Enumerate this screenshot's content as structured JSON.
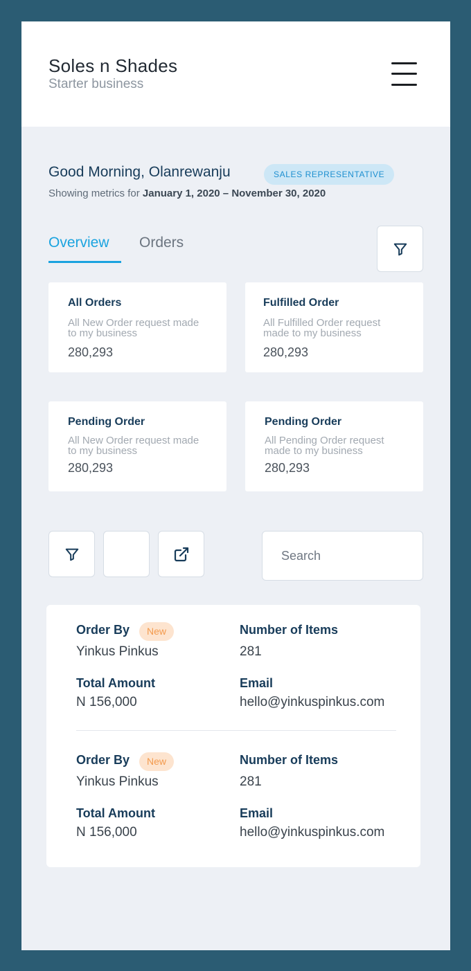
{
  "header": {
    "brand_name": "Soles n Shades",
    "brand_subtitle": "Starter business",
    "menu_icon": "hamburger-menu-icon"
  },
  "greeting": {
    "text": "Good Morning, Olanrewanju",
    "role_badge": "SALES REPRESENTATIVE",
    "metrics_prefix": "Showing metrics for ",
    "metrics_range": "January 1, 2020 – November 30, 2020"
  },
  "tabs": [
    {
      "label": "Overview",
      "active": true
    },
    {
      "label": "Orders",
      "active": false
    }
  ],
  "filter_icon": "filter-icon",
  "cards": [
    {
      "title": "All Orders",
      "description": "All New Order request made to my business",
      "value": "280,293"
    },
    {
      "title": "Fulfilled Order",
      "description": "All Fulfilled Order request made to my business",
      "value": "280,293"
    },
    {
      "title": "Pending Order",
      "description": "All New Order request made to my business",
      "value": "280,293"
    },
    {
      "title": "Pending Order",
      "description": "All Pending Order request made to my business",
      "value": "280,293"
    }
  ],
  "toolbar": {
    "filter_icon": "filter-icon",
    "export_icon": "external-link-icon",
    "search_placeholder": "Search"
  },
  "orders": [
    {
      "order_by_label": "Order By",
      "badge": "New",
      "order_by": "Yinkus Pinkus",
      "items_label": "Number of Items",
      "items": "281",
      "amount_label": "Total Amount",
      "amount": "N 156,000",
      "email_label": "Email",
      "email": "hello@yinkuspinkus.com"
    },
    {
      "order_by_label": "Order By",
      "badge": "New",
      "order_by": "Yinkus Pinkus",
      "items_label": "Number of Items",
      "items": "281",
      "amount_label": "Total Amount",
      "amount": "N 156,000",
      "email_label": "Email",
      "email": "hello@yinkuspinkus.com"
    }
  ],
  "colors": {
    "frame": "#2b5c73",
    "accent": "#1aa3df",
    "navy_text": "#183c5a",
    "badge_new_bg": "#fde4cf",
    "badge_new_text": "#f39a4d"
  }
}
